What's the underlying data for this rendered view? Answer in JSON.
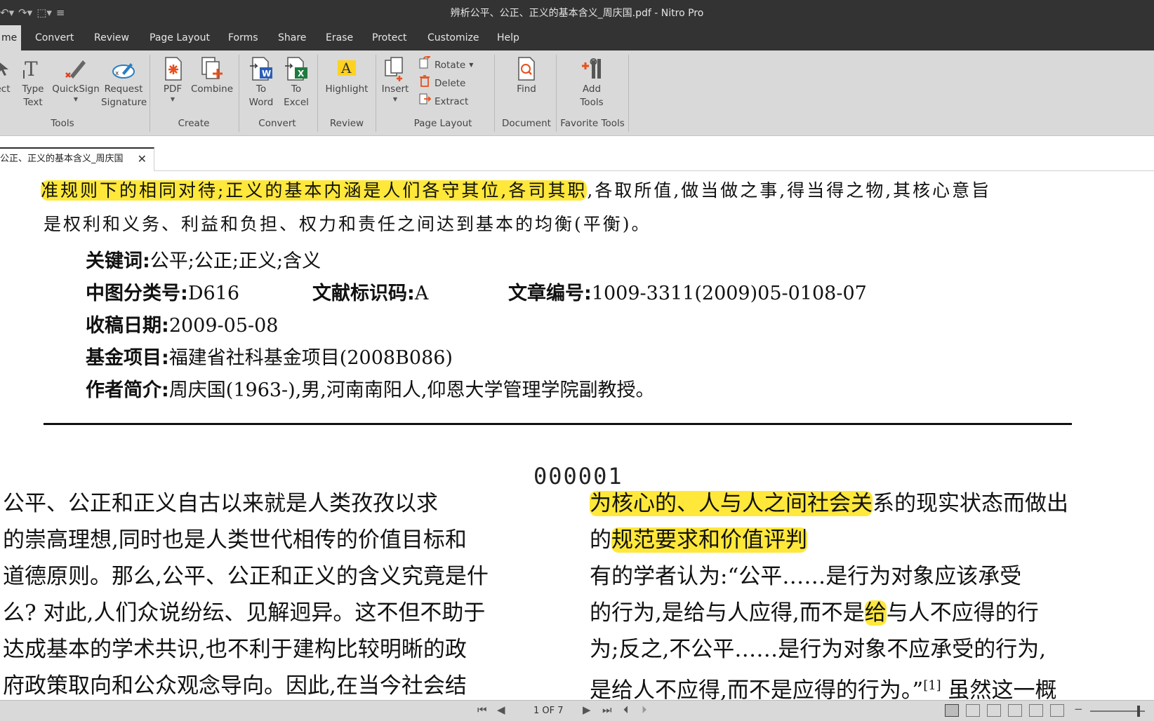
{
  "window": {
    "title": "辨析公平、公正、正义的基本含义_周庆国.pdf - Nitro Pro"
  },
  "menu": {
    "tabs": [
      "me",
      "Convert",
      "Review",
      "Page Layout",
      "Forms",
      "Share",
      "Erase",
      "Protect",
      "Customize",
      "Help"
    ],
    "active": "me"
  },
  "ribbon": {
    "tools": {
      "select_label": "ect",
      "type_text_label": "Type Text",
      "quicksign_label": "QuickSign",
      "request_signature_label": "Request Signature",
      "group": "Tools"
    },
    "create": {
      "pdf_label": "PDF",
      "combine_label": "Combine",
      "group": "Create"
    },
    "convert": {
      "to_word_label": "To Word",
      "to_excel_label": "To Excel",
      "group": "Convert"
    },
    "review": {
      "highlight_label": "Highlight",
      "group": "Review"
    },
    "page_layout": {
      "insert_label": "Insert",
      "rotate_label": "Rotate",
      "delete_label": "Delete",
      "extract_label": "Extract",
      "group": "Page Layout"
    },
    "document": {
      "find_label": "Find",
      "group": "Document"
    },
    "favorite": {
      "add_tools_label": "Add Tools",
      "group": "Favorite Tools"
    }
  },
  "doc_tab": {
    "title": "公正、正义的基本含义_周庆国"
  },
  "document": {
    "abstract_line1_hl": "准规则下的相同对待;正义的基本内涵是人们各守其位,各司其职",
    "abstract_line1_rest": ",各取所值,做当做之事,得当得之物,其核心意旨",
    "abstract_line2": "是权利和义务、利益和负担、权力和责任之间达到基本的均衡(平衡)。",
    "keywords_label": "关键词:",
    "keywords": "公平;公正;正义;含义",
    "clc_label": "中图分类号:",
    "clc": "D616",
    "doc_code_label": "文献标识码:",
    "doc_code": "A",
    "article_no_label": "文章编号:",
    "article_no": "1009-3311(2009)05-0108-07",
    "received_label": "收稿日期:",
    "received": "2009-05-08",
    "fund_label": "基金项目:",
    "fund": "福建省社科基金项目(2008B086)",
    "author_label": "作者简介:",
    "author": "周庆国(1963-),男,河南南阳人,仰恩大学管理学院副教授。",
    "page_code": "000001",
    "left_col": [
      "  公平、公正和正义自古以来就是人类孜孜以求",
      "的崇高理想,同时也是人类世代相传的价值目标和",
      "道德原则。那么,公平、公正和正义的含义究竟是什",
      "么? 对此,人们众说纷纭、见解迥异。这不但不助于",
      "达成基本的学术共识,也不利于建构比较明晰的政",
      "府政策取向和公众观念导向。因此,在当今社会结"
    ],
    "right_col": {
      "l1_hl": "为核心的、人与人之间社会关",
      "l1_rest": "系的现实状态而做出",
      "l2_pre": "的",
      "l2_hl": "规范要求和价值评判",
      "l3": "  有的学者认为:“公平……是行为对象应该承受",
      "l4_pre": "的行为,是给与人应得,而不是",
      "l4_hl": "给",
      "l4_rest": "与人不应得的行",
      "l5": "为;反之,不公平……是行为对象不应承受的行为,",
      "l6_pre": "是给人不应得,而不是应得的行为。”",
      "l6_sup": "[1]",
      "l6_rest": " 虽然这一概"
    }
  },
  "status": {
    "page_info": "1 OF 7"
  },
  "colors": {
    "highlight": "#ffe83a",
    "titlebar": "#333333",
    "ribbon": "#d9d9d9"
  }
}
